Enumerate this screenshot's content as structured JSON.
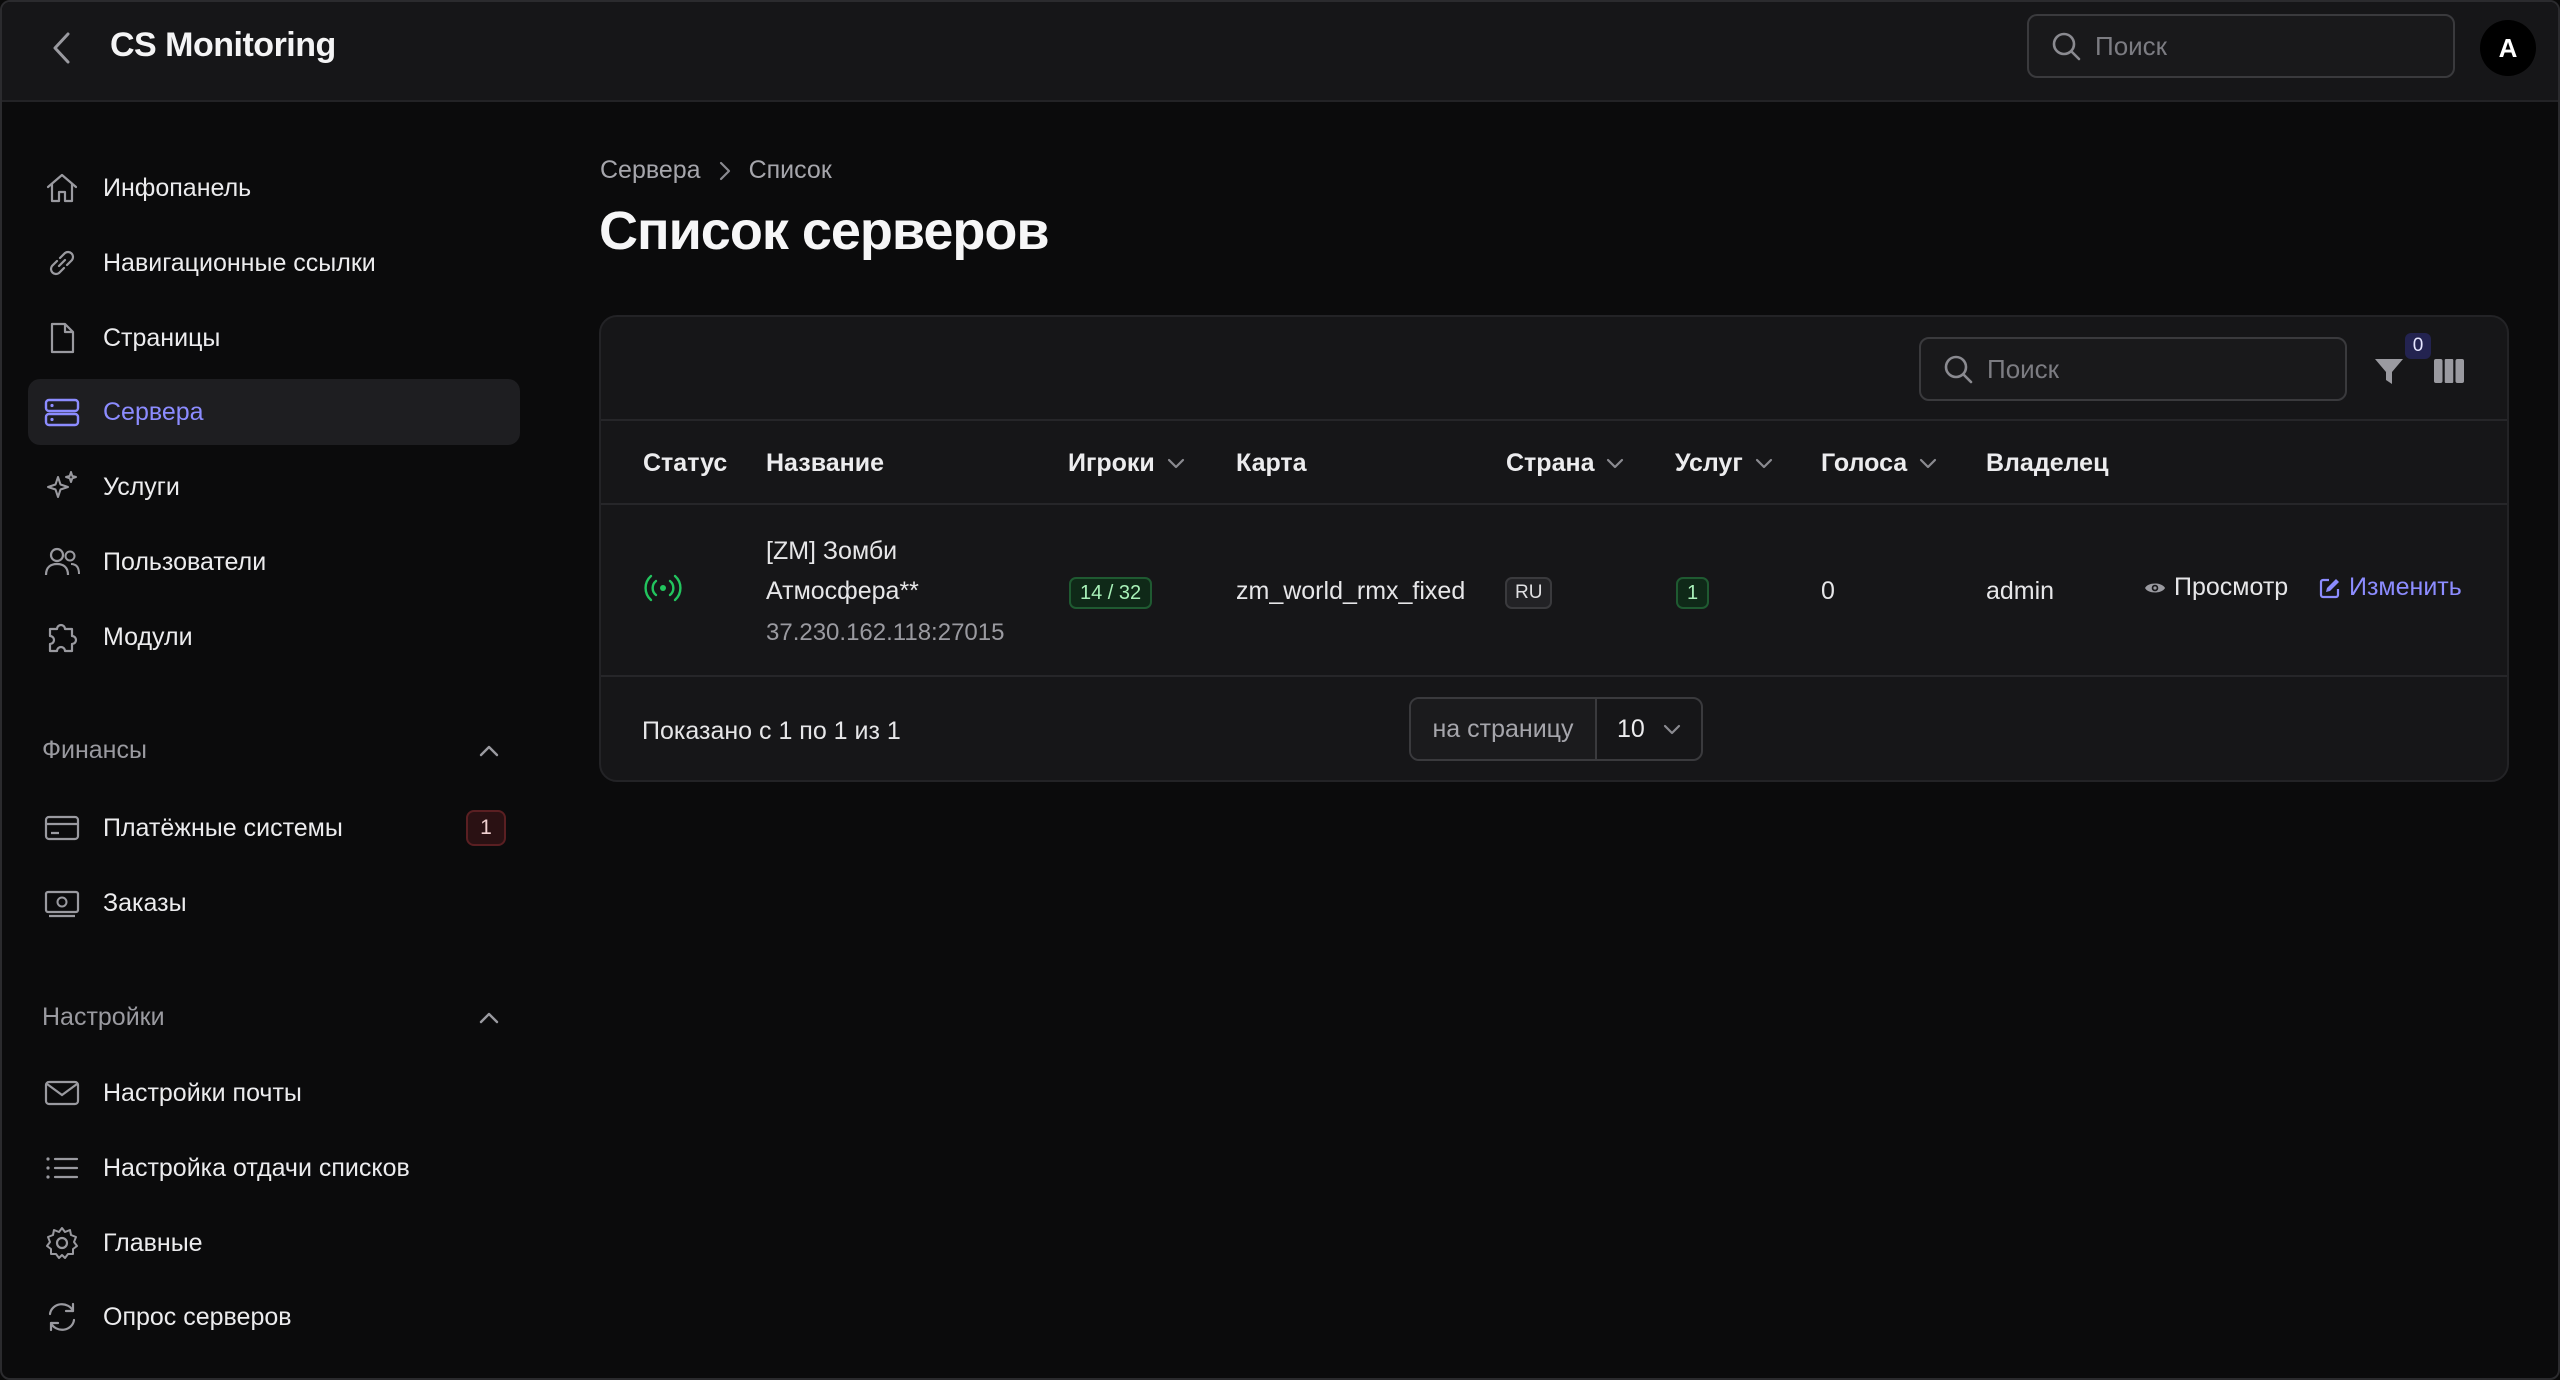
{
  "header": {
    "app_title": "CS Monitoring",
    "search_placeholder": "Поиск",
    "avatar_initial": "A"
  },
  "sidebar": {
    "items": [
      {
        "label": "Инфопанель",
        "icon": "home-icon"
      },
      {
        "label": "Навигационные ссылки",
        "icon": "link-icon"
      },
      {
        "label": "Страницы",
        "icon": "document-icon"
      },
      {
        "label": "Сервера",
        "icon": "server-icon",
        "active": true
      },
      {
        "label": "Услуги",
        "icon": "sparkles-icon"
      },
      {
        "label": "Пользователи",
        "icon": "users-icon"
      },
      {
        "label": "Модули",
        "icon": "puzzle-icon"
      }
    ],
    "finance": {
      "title": "Финансы",
      "items": [
        {
          "label": "Платёжные системы",
          "icon": "credit-card-icon",
          "badge": "1"
        },
        {
          "label": "Заказы",
          "icon": "cash-icon"
        }
      ]
    },
    "settings": {
      "title": "Настройки",
      "items": [
        {
          "label": "Настройки почты",
          "icon": "envelope-icon"
        },
        {
          "label": "Настройка отдачи списков",
          "icon": "list-icon"
        },
        {
          "label": "Главные",
          "icon": "cog-icon"
        },
        {
          "label": "Опрос серверов",
          "icon": "refresh-icon"
        }
      ]
    }
  },
  "breadcrumb": [
    "Сервера",
    "Список"
  ],
  "page_title": "Список серверов",
  "table": {
    "search_placeholder": "Поиск",
    "filter_count": "0",
    "columns": [
      "Статус",
      "Название",
      "Игроки",
      "Карта",
      "Страна",
      "Услуг",
      "Голоса",
      "Владелец"
    ],
    "rows": [
      {
        "status": "online",
        "name_line1": "[ZM] Зомби",
        "name_line2": "Атмосфера**",
        "address": "37.230.162.118:27015",
        "players": "14 / 32",
        "map": "zm_world_rmx_fixed",
        "country": "RU",
        "services": "1",
        "votes": "0",
        "owner": "admin",
        "view_label": "Просмотр",
        "edit_label": "Изменить"
      }
    ],
    "footer": {
      "shown_text": "Показано с 1 по 1 из 1",
      "per_page_label": "на страницу",
      "per_page_value": "10"
    }
  },
  "colors": {
    "accent": "#8c8cff",
    "status_online": "#22c55e",
    "badge_danger": "#5a1f22"
  }
}
